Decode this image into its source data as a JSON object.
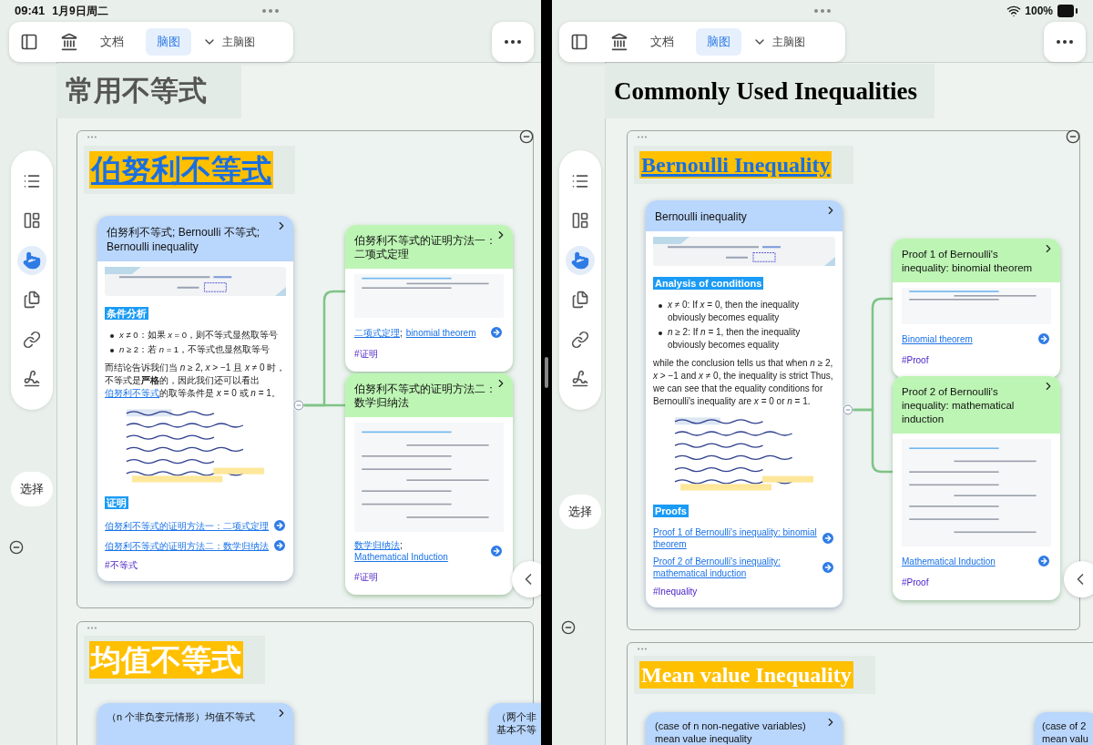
{
  "panes": [
    {
      "status_bar": {
        "time": "09:41",
        "date": "1月9日周二"
      },
      "toolbar": {
        "tabs": [
          {
            "label": "文档",
            "selected": false
          },
          {
            "label": "脑图",
            "selected": true
          }
        ],
        "map_selector": "主脑图"
      },
      "side_tools": {
        "items": [
          {
            "kind": "list",
            "selected": false
          },
          {
            "kind": "layout",
            "selected": false
          },
          {
            "kind": "hand",
            "selected": true
          },
          {
            "kind": "copy",
            "selected": false
          },
          {
            "kind": "link",
            "selected": false
          },
          {
            "kind": "draw",
            "selected": false
          }
        ],
        "select_label": "选择"
      },
      "page_title": "常用不等式",
      "sections": [
        {
          "heading": "伯努利不等式",
          "heading_link": true,
          "main_card": {
            "title": "伯努利不等式; Bernoulli 不等式; Bernoulli inequality",
            "blocks": [
              {
                "kind": "picture"
              },
              {
                "kind": "heading",
                "text": "条件分析"
              },
              {
                "kind": "bullets",
                "items": [
                  "*x* ≠ 0：如果 *x* = 0，则不等式显然取等号",
                  "*n* ≥ 2：若 *n* = 1，不等式也显然取等号"
                ]
              },
              {
                "kind": "paragraph",
                "parts": [
                  {
                    "text": "而结论告诉我们当 *n* ≥ 2, *x* > −1 且 *x* ≠ 0 时，不等式是**严格**的，因此我们还可以看出"
                  },
                  {
                    "link": "伯努利不等式"
                  },
                  {
                    "text": "的取等条件是 *x* = 0 或 *n* = 1。"
                  }
                ]
              },
              {
                "kind": "picture"
              },
              {
                "kind": "heading",
                "text": "证明"
              },
              {
                "kind": "links",
                "items": [
                  "伯努利不等式的证明方法一：二项式定理",
                  "伯努利不等式的证明方法二：数学归纳法"
                ]
              },
              {
                "kind": "tag",
                "text": "#不等式"
              }
            ]
          },
          "sub_cards": [
            {
              "title": "伯努利不等式的证明方法一：二项式定理",
              "links": [
                "二项式定理",
                "binomial theorem"
              ],
              "separator": ";",
              "tag": "#证明"
            },
            {
              "title": "伯努利不等式的证明方法二：数学归纳法",
              "links": [
                "数学归纳法",
                "Mathematical Induction"
              ],
              "separator": ";",
              "tag": "#证明"
            }
          ]
        },
        {
          "heading": "均值不等式",
          "heading_link": false,
          "cards": [
            {
              "title_lines": [
                "（n 个非负变元情形）均值不等式"
              ]
            },
            {
              "title_lines": [
                "（两个非",
                "基本不等"
              ]
            }
          ]
        }
      ]
    },
    {
      "status_bar": {
        "battery": "100%"
      },
      "toolbar": {
        "tabs": [
          {
            "label": "文档",
            "selected": false
          },
          {
            "label": "脑图",
            "selected": true
          }
        ],
        "map_selector": "主脑图"
      },
      "side_tools": {
        "items": [
          {
            "kind": "list",
            "selected": false
          },
          {
            "kind": "layout",
            "selected": false
          },
          {
            "kind": "hand",
            "selected": true
          },
          {
            "kind": "copy",
            "selected": false
          },
          {
            "kind": "link",
            "selected": false
          },
          {
            "kind": "draw",
            "selected": false
          }
        ],
        "select_label": "选择"
      },
      "page_title": "Commonly Used Inequalities",
      "sections": [
        {
          "heading": "Bernoulli Inequality",
          "heading_link": true,
          "main_card": {
            "title": "Bernoulli inequality",
            "blocks": [
              {
                "kind": "picture"
              },
              {
                "kind": "heading",
                "text": "Analysis of conditions"
              },
              {
                "kind": "bullets",
                "items": [
                  "*x* ≠ 0: If *x* = 0, then the inequality obviously becomes equality",
                  "*n* ≥ 2: If *n* = 1, then the inequality obviously becomes equality"
                ]
              },
              {
                "kind": "paragraph",
                "parts": [
                  {
                    "text": "while the conclusion tells us that when *n* ≥ 2, *x* > −1 and *x* ≠ 0, the inequality is strict Thus, we can see that the equality conditions for Bernoulli's inequality are *x* = 0 or *n* = 1."
                  }
                ]
              },
              {
                "kind": "picture"
              },
              {
                "kind": "heading",
                "text": "Proofs"
              },
              {
                "kind": "links",
                "items": [
                  "Proof 1 of Bernoulli's inequality: binomial theorem",
                  "Proof 2 of Bernoulli's inequality: mathematical induction"
                ]
              },
              {
                "kind": "tag",
                "text": "#Inequality"
              }
            ]
          },
          "sub_cards": [
            {
              "title": "Proof 1 of Bernoulli's inequality: binomial theorem",
              "links": [
                "Binomial theorem"
              ],
              "tag": "#Proof"
            },
            {
              "title": "Proof 2 of Bernoulli's inequality: mathematical induction",
              "links": [
                "Mathematical Induction"
              ],
              "tag": "#Proof"
            }
          ]
        },
        {
          "heading": "Mean value Inequality",
          "heading_link": false,
          "cards": [
            {
              "title_lines": [
                "(case of n non-negative variables)",
                "mean value inequality"
              ]
            },
            {
              "title_lines": [
                "(case of 2",
                "mean valu"
              ]
            }
          ]
        }
      ]
    }
  ]
}
